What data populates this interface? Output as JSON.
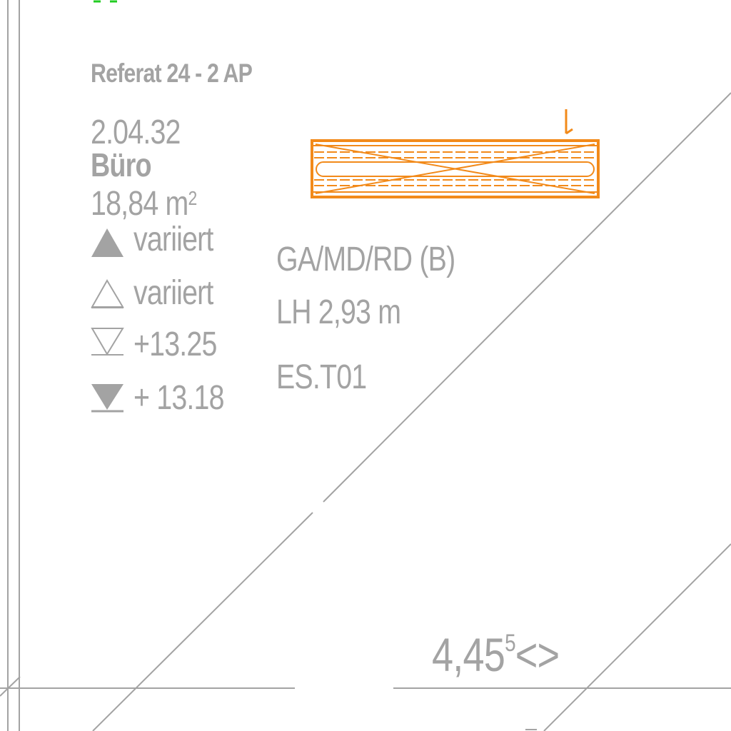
{
  "room": {
    "department": "Referat 24 -  2 AP",
    "number": "2.04.32",
    "name": "Büro",
    "area_value": "18,84 m",
    "area_unit_sup": "2",
    "levels": [
      {
        "icon": "filled-up-triangle-icon",
        "text": "variiert"
      },
      {
        "icon": "outline-up-triangle-icon",
        "text": "variiert"
      },
      {
        "icon": "outline-down-triangle-icon",
        "text": "+13.25"
      },
      {
        "icon": "filled-down-triangle-icon",
        "text": "+ 13.18"
      }
    ],
    "finish_code": "GA/MD/RD (B)",
    "clear_height": "LH 2,93 m",
    "element_code": "ES.T01"
  },
  "dimension": {
    "value": "4,45",
    "superscript": "5",
    "suffix": "<>"
  },
  "colors": {
    "line_gray": "#a3a3a3",
    "text_gray": "#a3a3a3",
    "accent_orange": "#f28a1a",
    "marker_green": "#22cc22"
  }
}
